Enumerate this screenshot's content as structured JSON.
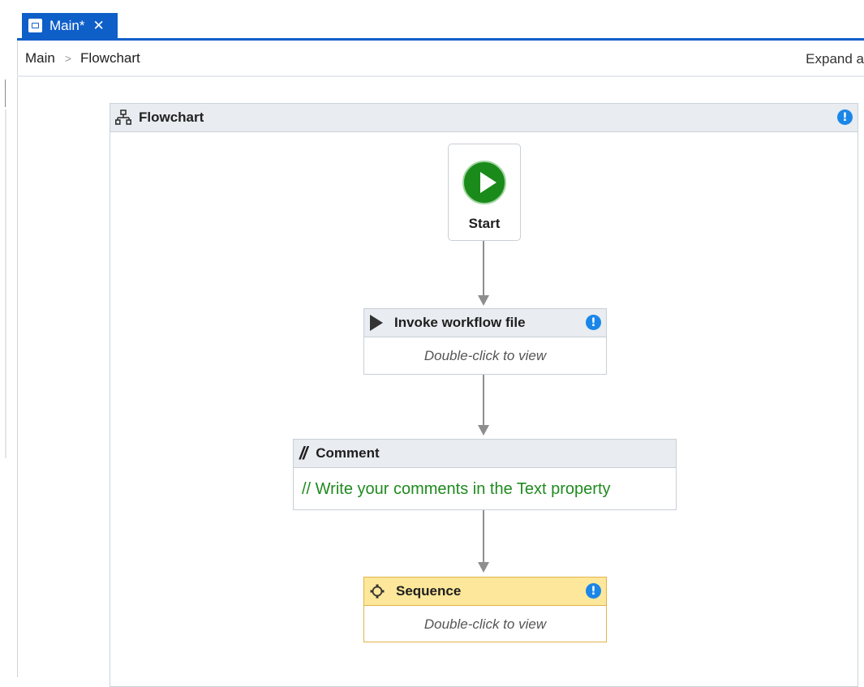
{
  "tab": {
    "label": "Main*",
    "close": "✕",
    "icon": "workflow-file-icon"
  },
  "breadcrumb": {
    "items": [
      "Main",
      "Flowchart"
    ],
    "separator": ">",
    "expand_label": "Expand a"
  },
  "flowchart": {
    "title": "Flowchart",
    "start": {
      "label": "Start"
    },
    "invoke": {
      "title": "Invoke workflow file",
      "body": "Double-click to view"
    },
    "comment": {
      "title": "Comment",
      "body": "// Write your comments in the Text property",
      "icon": "//"
    },
    "sequence": {
      "title": "Sequence",
      "body": "Double-click to view"
    },
    "info_glyph": "!"
  },
  "colors": {
    "accent": "#0f5fc9",
    "start_green": "#1a8a1a",
    "comment_green": "#1f8a1f",
    "sequence_header": "#fde79a"
  }
}
